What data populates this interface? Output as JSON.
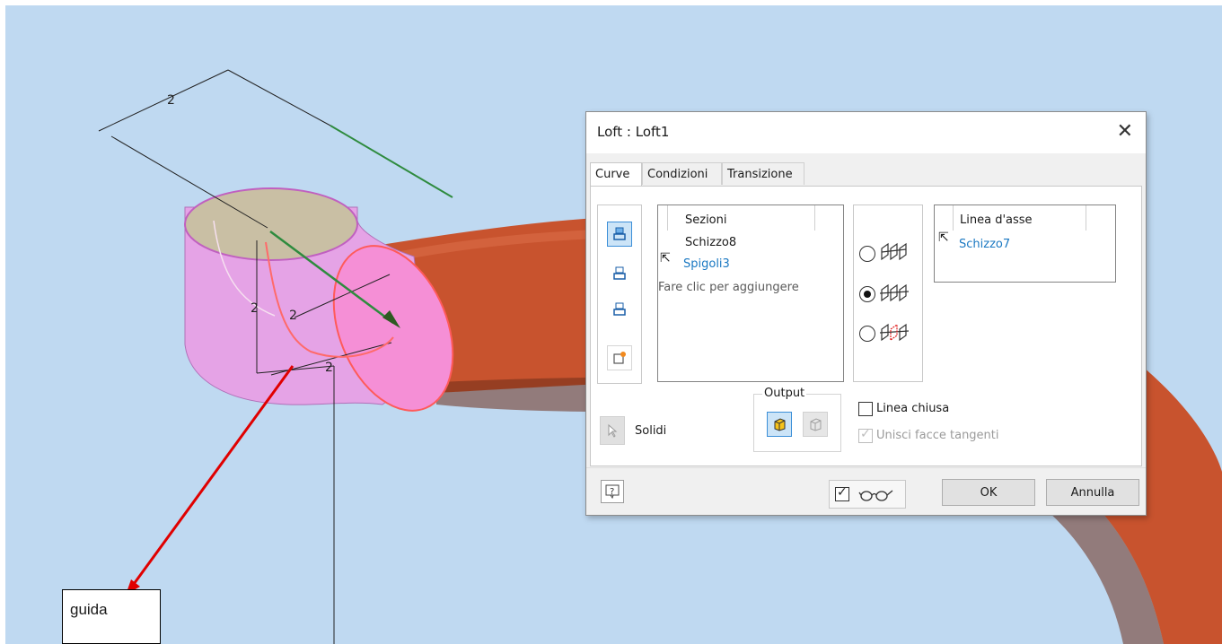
{
  "viewport": {
    "dimension_labels": [
      "2",
      "2",
      "2",
      "2",
      "2"
    ],
    "callout": "guida",
    "colors": {
      "background": "#bfd9f1",
      "pipe": "#c8532e",
      "loft": "#e9a0e4",
      "section": "#ff7bd0",
      "arrow": "#e00000",
      "path": "#2e8b3e"
    }
  },
  "dialog": {
    "title": "Loft : Loft1",
    "close_icon": "close-icon",
    "tabs": [
      "Curve",
      "Condizioni",
      "Transizione"
    ],
    "active_tab": "Curve",
    "sections": {
      "header": "Sezioni",
      "items": [
        "Schizzo8",
        "Spigoli3"
      ],
      "add_hint": "Fare clic per aggiungere"
    },
    "rail": {
      "header": "Linea d'asse",
      "items": [
        "Schizzo7"
      ]
    },
    "selection_mode": [
      "sections-rails",
      "centerline",
      "area-loft"
    ],
    "selection_mode_selected": "centerline",
    "output": {
      "legend": "Output",
      "solid_label": "Solidi",
      "selected": "solid"
    },
    "closed_loop": {
      "label": "Linea chiusa",
      "checked": false
    },
    "merge_tangent": {
      "label": "Unisci facce tangenti",
      "checked": true,
      "disabled": true
    },
    "buttons": {
      "ok": "OK",
      "cancel": "Annulla"
    },
    "preview": {
      "checked": true,
      "icon": "glasses-icon"
    },
    "help_icon": "help-icon"
  }
}
